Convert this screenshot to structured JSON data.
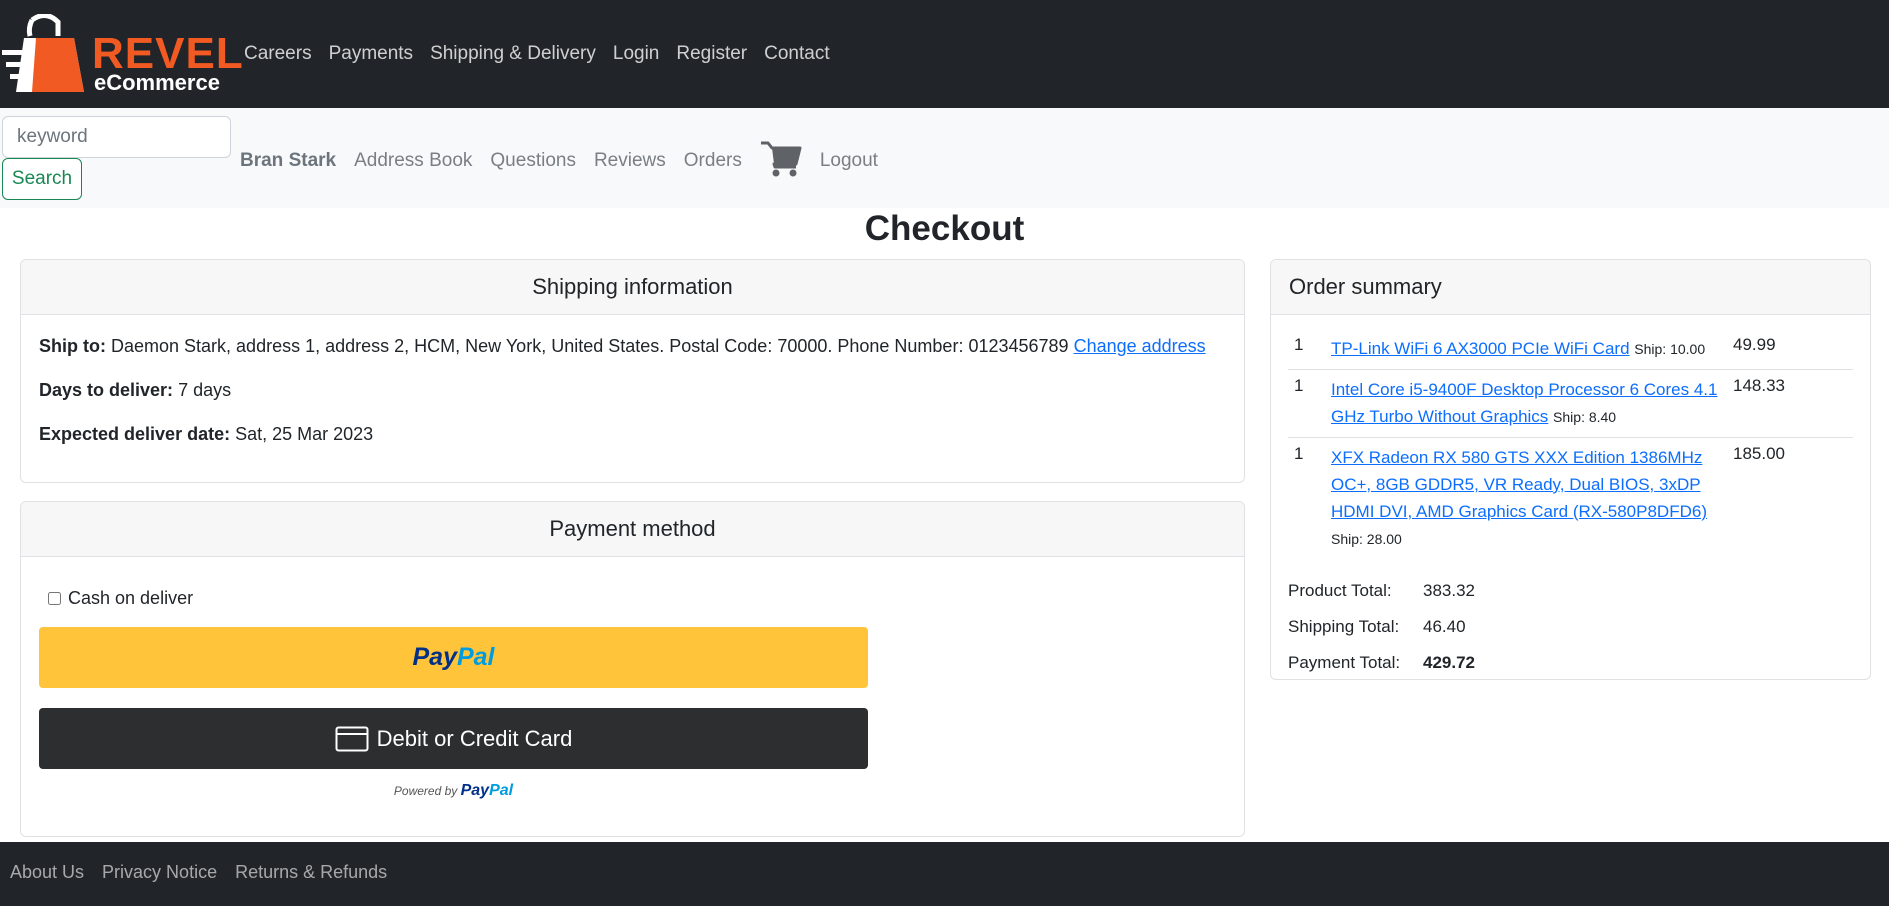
{
  "brand": {
    "name": "REVEL",
    "tagline": "eCommerce",
    "accent_color": "#f15a22"
  },
  "top_nav": [
    "Careers",
    "Payments",
    "Shipping & Delivery",
    "Login",
    "Register",
    "Contact"
  ],
  "search": {
    "placeholder": "keyword",
    "button_label": "Search"
  },
  "account_nav": {
    "user_name": "Bran Stark",
    "links": [
      "Address Book",
      "Questions",
      "Reviews",
      "Orders"
    ],
    "cart_icon": "cart-icon",
    "logout": "Logout"
  },
  "page_title": "Checkout",
  "shipping": {
    "header": "Shipping information",
    "ship_to_label": "Ship to:",
    "ship_to_value": "Daemon Stark, address 1, address 2, HCM, New York, United States. Postal Code: 70000. Phone Number: 0123456789",
    "change_address": "Change address",
    "days_label": "Days to deliver:",
    "days_value": "7 days",
    "expected_label": "Expected deliver date:",
    "expected_value": "Sat, 25 Mar 2023"
  },
  "payment": {
    "header": "Payment method",
    "cod_label": "Cash on deliver",
    "cod_checked": false,
    "paypal_pay": "Pay",
    "paypal_pal": "Pal",
    "card_button": "Debit or Credit Card",
    "powered_by": "Powered by"
  },
  "summary": {
    "header": "Order summary",
    "items": [
      {
        "qty": "1",
        "name": "TP-Link WiFi 6 AX3000 PCIe WiFi Card",
        "ship": "Ship: 10.00",
        "price": "49.99"
      },
      {
        "qty": "1",
        "name": "Intel Core i5-9400F Desktop Processor 6 Cores 4.1 GHz Turbo Without Graphics",
        "ship": "Ship: 8.40",
        "price": "148.33"
      },
      {
        "qty": "1",
        "name": "XFX Radeon RX 580 GTS XXX Edition 1386MHz OC+, 8GB GDDR5, VR Ready, Dual BIOS, 3xDP HDMI DVI, AMD Graphics Card (RX-580P8DFD6)",
        "ship": "Ship: 28.00",
        "price": "185.00"
      }
    ],
    "product_total_label": "Product Total:",
    "product_total": "383.32",
    "shipping_total_label": "Shipping Total:",
    "shipping_total": "46.40",
    "payment_total_label": "Payment Total:",
    "payment_total": "429.72"
  },
  "footer": [
    "About Us",
    "Privacy Notice",
    "Returns & Refunds"
  ],
  "colors": {
    "dark": "#212529",
    "paypal_yellow": "#ffc439",
    "link": "#0d6efd",
    "search_green": "#198754"
  }
}
